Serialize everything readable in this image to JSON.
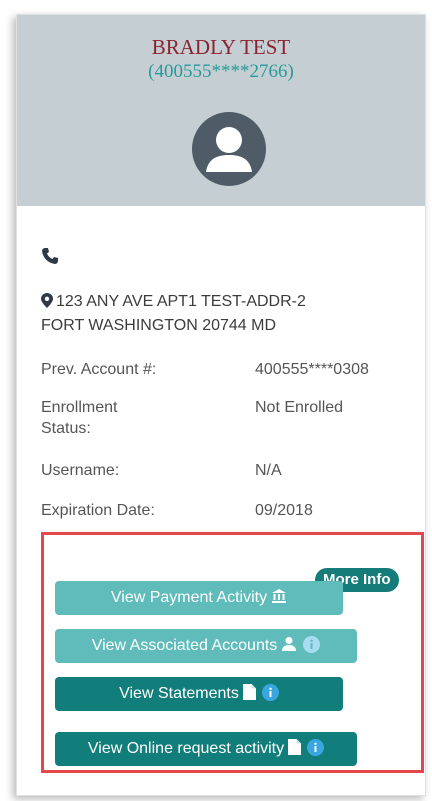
{
  "holder": {
    "name": "BRADLY TEST",
    "account_masked": "(400555****2766)"
  },
  "contact": {
    "address_line1": "123 ANY AVE APT1 TEST-ADDR-2",
    "address_line2": "FORT WASHINGTON 20744 MD"
  },
  "details": {
    "prev_account_label": "Prev. Account #:",
    "prev_account_value": "400555****0308",
    "enrollment_label": "Enrollment Status:",
    "enrollment_value": "Not Enrolled",
    "username_label": "Username:",
    "username_value": "N/A",
    "expiration_label": "Expiration Date:",
    "expiration_value": "09/2018"
  },
  "actions": {
    "more_info_label": "More Info",
    "payment_activity_label": "View Payment Activity",
    "associated_accounts_label": "View Associated Accounts",
    "statements_label": "View Statements",
    "online_request_label": "View Online request activity"
  },
  "icons": {
    "phone": "phone-icon",
    "location": "map-pin-icon",
    "user": "user-icon",
    "bank": "bank-icon",
    "document": "document-icon",
    "info": "info-icon"
  },
  "colors": {
    "header_bg": "#c5ced3",
    "name": "#8b2430",
    "account": "#2a9a98",
    "button_light": "#5fbcba",
    "button_dark": "#127e7b",
    "more_info": "#167c79",
    "highlight_border": "#e2484d"
  }
}
